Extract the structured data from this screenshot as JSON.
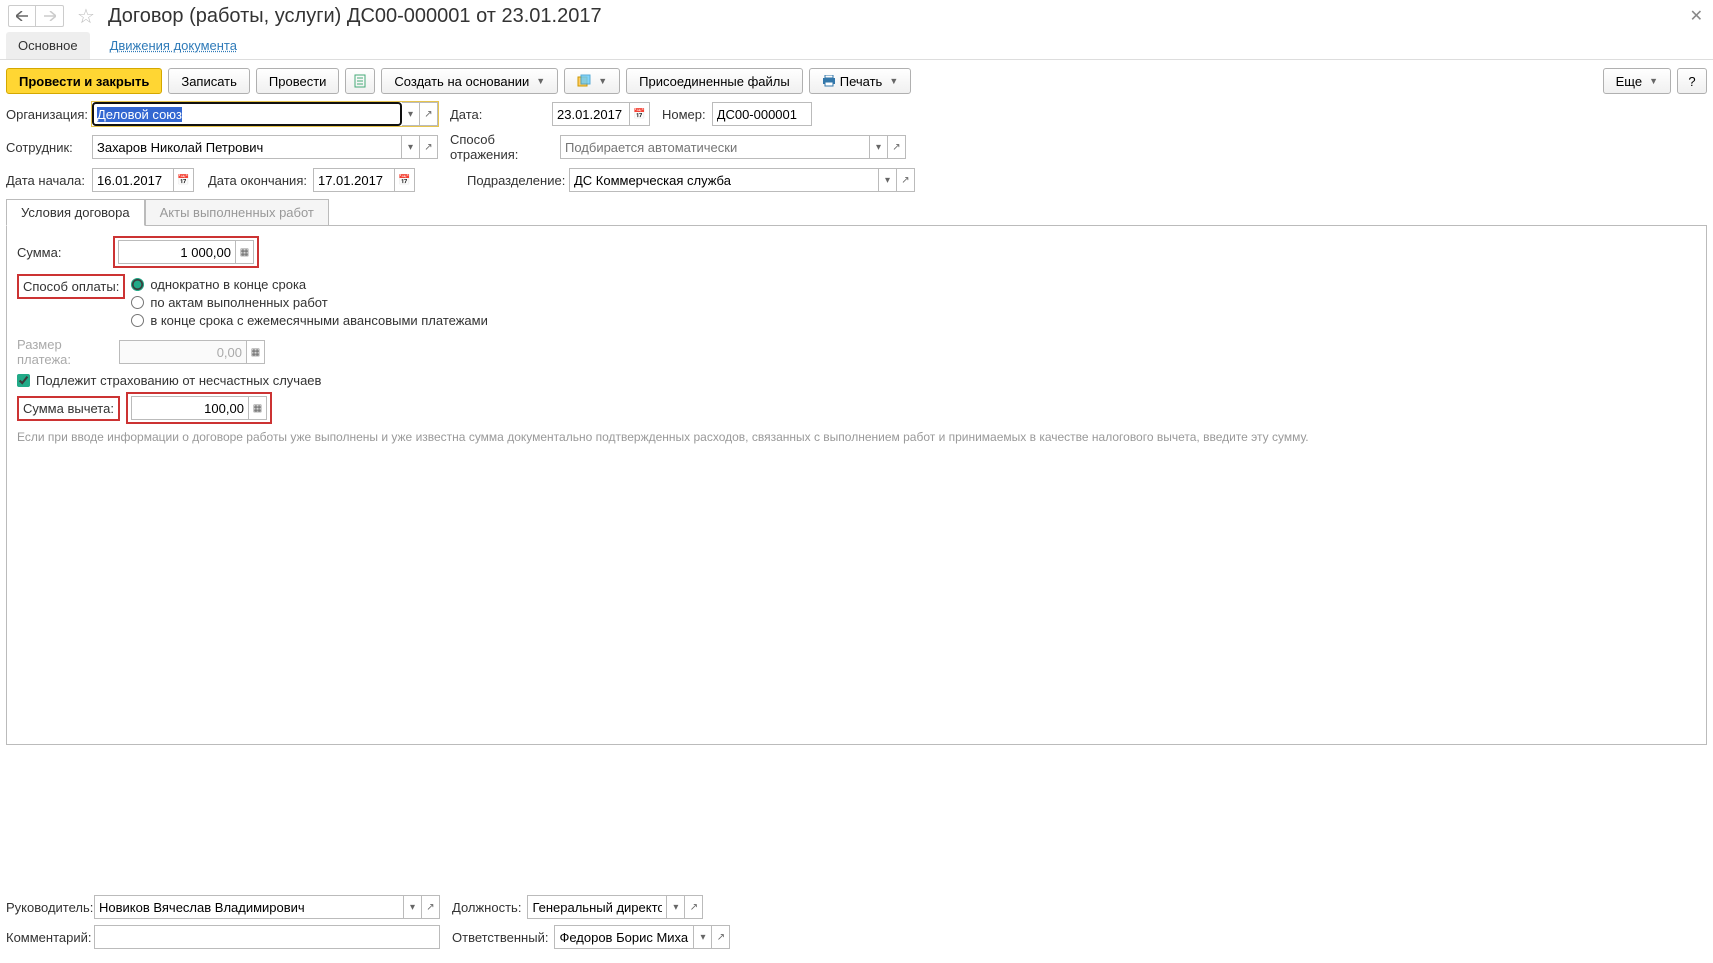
{
  "title": "Договор (работы, услуги) ДС00-000001 от 23.01.2017",
  "section_tabs": {
    "main": "Основное",
    "movements": "Движения документа"
  },
  "toolbar": {
    "post_close": "Провести и закрыть",
    "save": "Записать",
    "post": "Провести",
    "create_based": "Создать на основании",
    "attached": "Присоединенные файлы",
    "print": "Печать",
    "more": "Еще",
    "help": "?"
  },
  "fields": {
    "org_label": "Организация:",
    "org_value": "Деловой союз",
    "date_label": "Дата:",
    "date_value": "23.01.2017",
    "number_label": "Номер:",
    "number_value": "ДС00-000001",
    "employee_label": "Сотрудник:",
    "employee_value": "Захаров Николай Петрович",
    "reflect_label": "Способ отражения:",
    "reflect_placeholder": "Подбирается автоматически",
    "start_label": "Дата начала:",
    "start_value": "16.01.2017",
    "end_label": "Дата окончания:",
    "end_value": "17.01.2017",
    "dept_label": "Подразделение:",
    "dept_value": "ДС Коммерческая служба"
  },
  "tabs": {
    "conditions": "Условия договора",
    "acts": "Акты выполненных работ"
  },
  "conditions": {
    "sum_label": "Сумма:",
    "sum_value": "1 000,00",
    "pay_method_label": "Способ оплаты:",
    "pay_opt1": "однократно в конце срока",
    "pay_opt2": "по актам выполненных работ",
    "pay_opt3": "в конце срока с ежемесячными авансовыми платежами",
    "payment_size_label": "Размер платежа:",
    "payment_size_value": "0,00",
    "insurance_label": "Подлежит страхованию от несчастных случаев",
    "deduction_label": "Сумма вычета:",
    "deduction_value": "100,00",
    "hint": "Если при вводе информации о договоре работы уже выполнены и уже известна сумма документально подтвержденных расходов, связанных с выполнением работ и принимаемых в качестве налогового вычета, введите эту сумму."
  },
  "bottom": {
    "manager_label": "Руководитель:",
    "manager_value": "Новиков Вячеслав Владимирович",
    "position_label": "Должность:",
    "position_value": "Генеральный директор",
    "comment_label": "Комментарий:",
    "responsible_label": "Ответственный:",
    "responsible_value": "Федоров Борис Михайлов"
  }
}
